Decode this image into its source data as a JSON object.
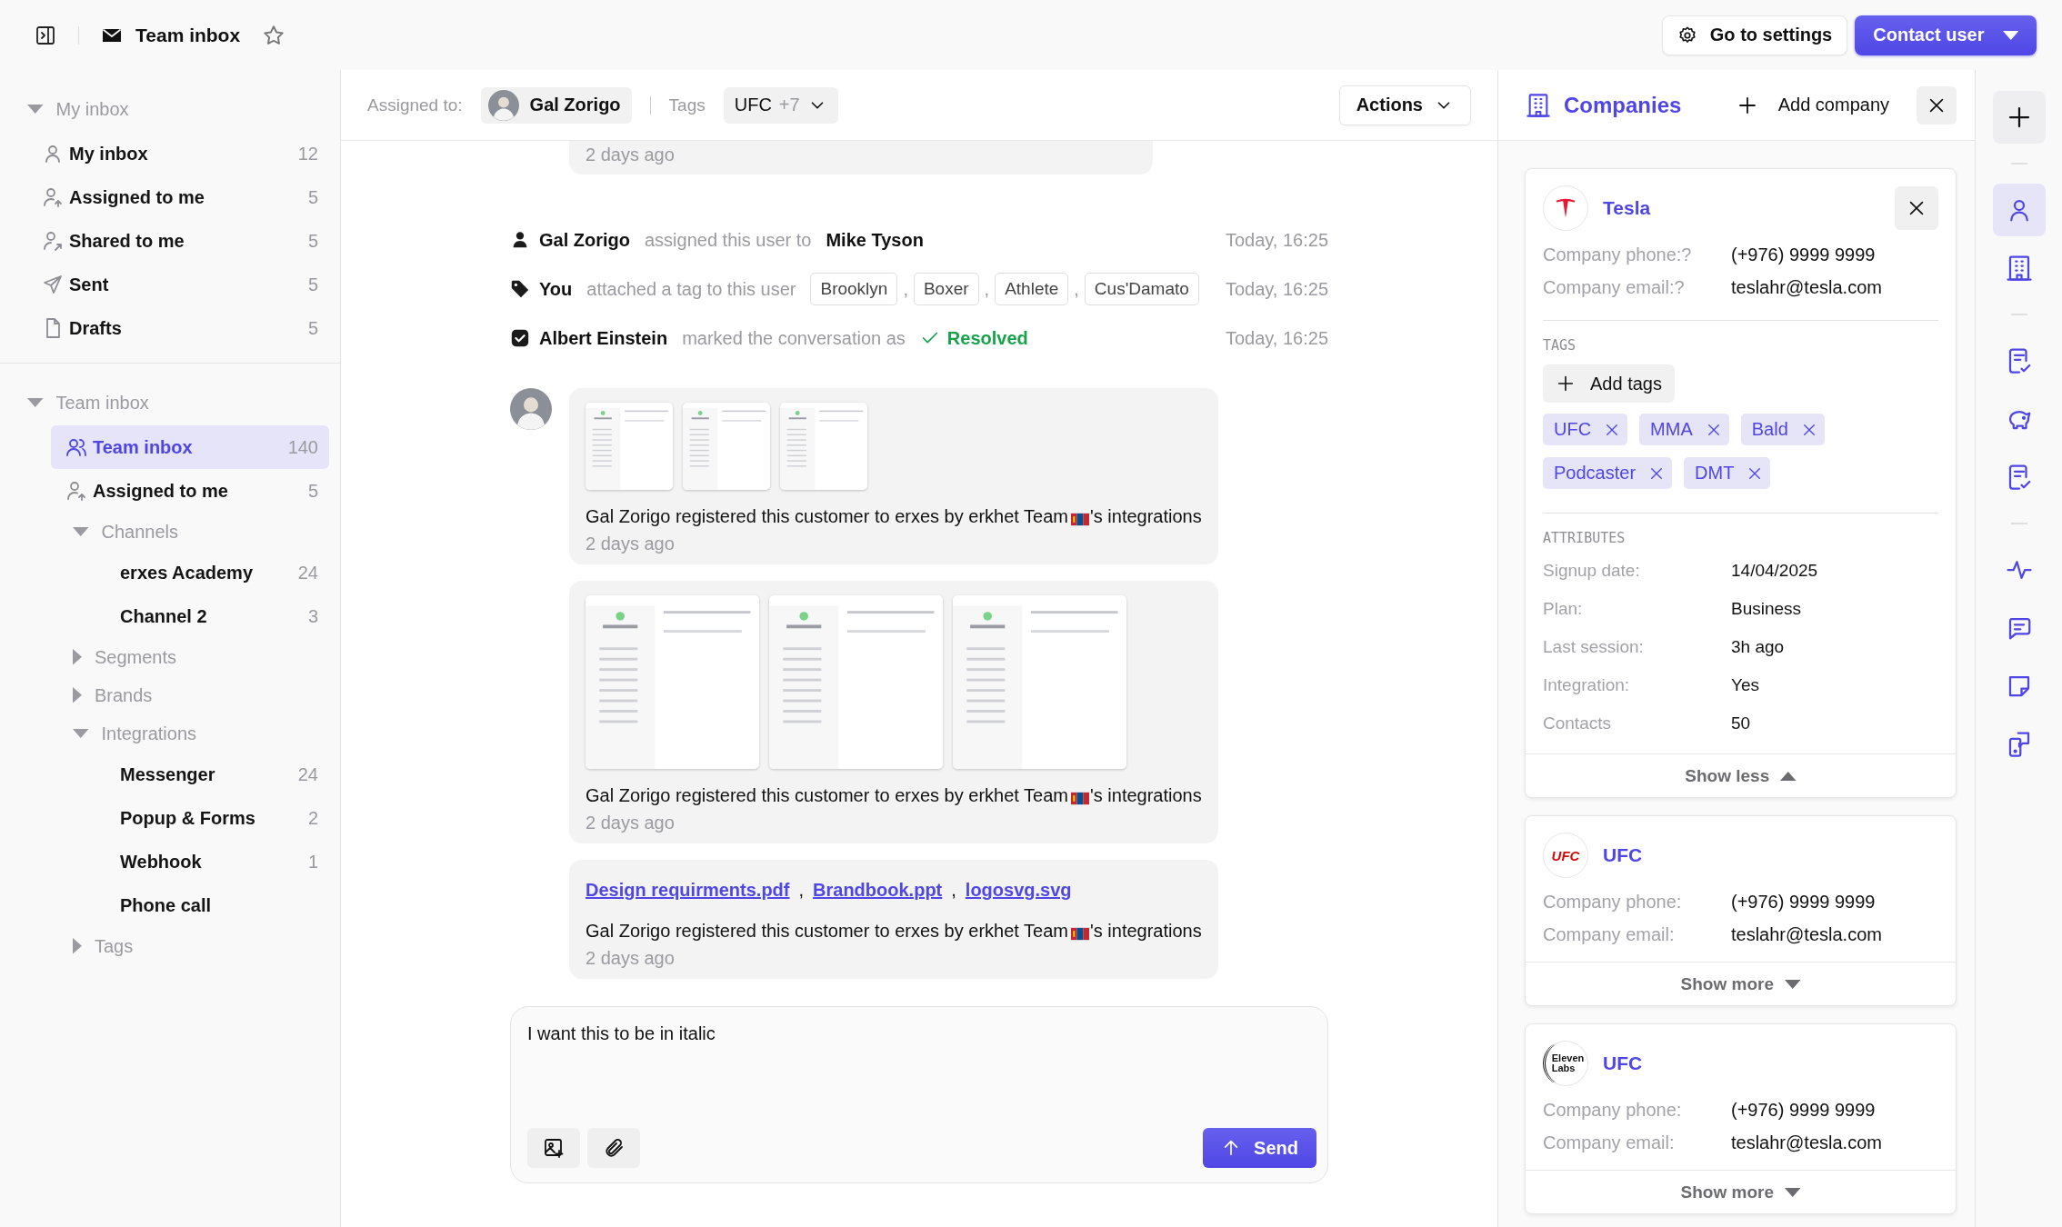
{
  "header": {
    "title": "Team inbox",
    "starred": false,
    "settings_button": "Go to settings",
    "contact_button": "Contact user"
  },
  "sidebar": {
    "sections": [
      {
        "label": "My inbox",
        "expanded": true,
        "children": [
          {
            "kind": "item",
            "label": "My inbox",
            "count": "12",
            "selected": false
          },
          {
            "kind": "item",
            "label": "Assigned to me",
            "count": "5",
            "selected": false
          },
          {
            "kind": "item",
            "label": "Shared to me",
            "count": "5",
            "selected": false
          },
          {
            "kind": "item",
            "label": "Sent",
            "count": "5",
            "selected": false
          },
          {
            "kind": "item",
            "label": "Drafts",
            "count": "5",
            "selected": false
          }
        ]
      },
      {
        "label": "Team inbox",
        "expanded": true,
        "children": [
          {
            "kind": "item",
            "label": "Team inbox",
            "count": "140",
            "selected": true
          },
          {
            "kind": "item",
            "label": "Assigned to me",
            "count": "5",
            "selected": false
          },
          {
            "kind": "group",
            "label": "Channels",
            "expanded": true,
            "children": [
              {
                "kind": "item",
                "label": "erxes Academy",
                "count": "24",
                "selected": false
              },
              {
                "kind": "item",
                "label": "Channel 2",
                "count": "3",
                "selected": false
              }
            ]
          },
          {
            "kind": "group",
            "label": "Segments",
            "expanded": false
          },
          {
            "kind": "group",
            "label": "Brands",
            "expanded": false
          },
          {
            "kind": "group",
            "label": "Integrations",
            "expanded": true,
            "children": [
              {
                "kind": "item",
                "label": "Messenger",
                "count": "24",
                "selected": false
              },
              {
                "kind": "item",
                "label": "Popup & Forms",
                "count": "2",
                "selected": false
              },
              {
                "kind": "item",
                "label": "Webhook",
                "count": "1",
                "selected": false
              },
              {
                "kind": "item",
                "label": "Phone call",
                "selected": false
              }
            ]
          },
          {
            "kind": "group",
            "label": "Tags",
            "expanded": false
          }
        ]
      }
    ]
  },
  "conversation": {
    "assigned_label": "Assigned to:",
    "assignee": "Gal Zorigo",
    "tags_label": "Tags",
    "tags_value": "UFC",
    "tags_more": "+7",
    "actions_button": "Actions",
    "feed": [
      {
        "kind": "message_tail",
        "time": "2 days ago"
      },
      {
        "kind": "assignment",
        "actor": "Gal Zorigo",
        "action": "assigned this user to",
        "target": "Mike Tyson",
        "time": "Today, 16:25"
      },
      {
        "kind": "tagging",
        "actor": "You",
        "action": "attached a tag to this user",
        "tags": [
          "Brooklyn",
          "Boxer",
          "Athlete",
          "Cus'Damato"
        ],
        "separator": ",",
        "time": "Today, 16:25"
      },
      {
        "kind": "resolution",
        "actor": "Albert Einstein",
        "action": "marked the conversation as",
        "status": "Resolved",
        "time": "Today, 16:25"
      },
      {
        "kind": "message",
        "show_avatar": true,
        "thumbnails": [
          {
            "kind": "thumbnail"
          },
          {
            "kind": "thumbnail"
          },
          {
            "kind": "thumbnail"
          }
        ],
        "parts": [
          {
            "kind": "text",
            "text": "Gal Zorigo registered this customer to erxes by erkhet Team"
          },
          {
            "kind": "flag"
          },
          {
            "kind": "text",
            "text": "'s integrations"
          }
        ],
        "time": "2 days ago"
      },
      {
        "kind": "message",
        "show_avatar": false,
        "thumbnails": [
          {
            "kind": "preview"
          },
          {
            "kind": "preview"
          },
          {
            "kind": "preview"
          }
        ],
        "parts": [
          {
            "kind": "text",
            "text": "Gal Zorigo registered this customer to erxes by erkhet Team"
          },
          {
            "kind": "flag"
          },
          {
            "kind": "text",
            "text": "'s integrations"
          }
        ],
        "time": "2 days ago"
      },
      {
        "kind": "message",
        "show_avatar": false,
        "files": [
          "Design requirments.pdf",
          "Brandbook.ppt",
          "logosvg.svg"
        ],
        "separator": ",",
        "parts": [
          {
            "kind": "text",
            "text": "Gal Zorigo registered this customer to erxes by erkhet Team"
          },
          {
            "kind": "flag"
          },
          {
            "kind": "text",
            "text": "'s integrations"
          }
        ],
        "time": "2 days ago"
      }
    ],
    "composer": {
      "value": "I want this to be in italic",
      "send_button": "Send"
    }
  },
  "companies": {
    "title": "Companies",
    "add_button": "Add company",
    "cards": [
      {
        "logo": {
          "kind": "emblem"
        },
        "name": "Tesla",
        "closable": true,
        "fields": [
          {
            "label": "Company phone:?",
            "value": "(+976) 9999 9999"
          },
          {
            "label": "Company email:?",
            "value": "teslahr@tesla.com"
          }
        ],
        "tags_title": "TAGS",
        "add_tags_button": "Add tags",
        "tags": [
          "UFC",
          "MMA",
          "Bald",
          "Podcaster",
          "DMT"
        ],
        "attributes_title": "ATTRIBUTES",
        "attributes": [
          {
            "label": "Signup date:",
            "value": "14/04/2025"
          },
          {
            "label": "Plan:",
            "value": "Business"
          },
          {
            "label": "Last session:",
            "value": "3h ago"
          },
          {
            "label": "Integration:",
            "value": "Yes"
          },
          {
            "label": "Contacts",
            "value": "50"
          }
        ],
        "expanded": true,
        "toggle": "Show less"
      },
      {
        "logo": {
          "kind": "wordmark",
          "text": "UFC"
        },
        "name": "UFC",
        "closable": false,
        "fields": [
          {
            "label": "Company phone:",
            "value": "(+976) 9999 9999"
          },
          {
            "label": "Company email:",
            "value": "teslahr@tesla.com"
          }
        ],
        "expanded": false,
        "toggle": "Show more"
      },
      {
        "logo": {
          "kind": "stacked",
          "text": "Eleven Labs"
        },
        "name": "UFC",
        "closable": false,
        "fields": [
          {
            "label": "Company phone:",
            "value": "(+976) 9999 9999"
          },
          {
            "label": "Company email:",
            "value": "teslahr@tesla.com"
          }
        ],
        "expanded": false,
        "toggle": "Show more"
      }
    ]
  },
  "rail": {
    "groups": [
      [
        {
          "selected": false
        }
      ],
      [
        {
          "selected": true
        },
        {
          "selected": false
        }
      ],
      [
        {
          "selected": false
        },
        {
          "selected": false
        },
        {
          "selected": false
        }
      ],
      [
        {
          "selected": false
        },
        {
          "selected": false
        },
        {
          "selected": false
        },
        {
          "selected": false
        }
      ]
    ]
  }
}
